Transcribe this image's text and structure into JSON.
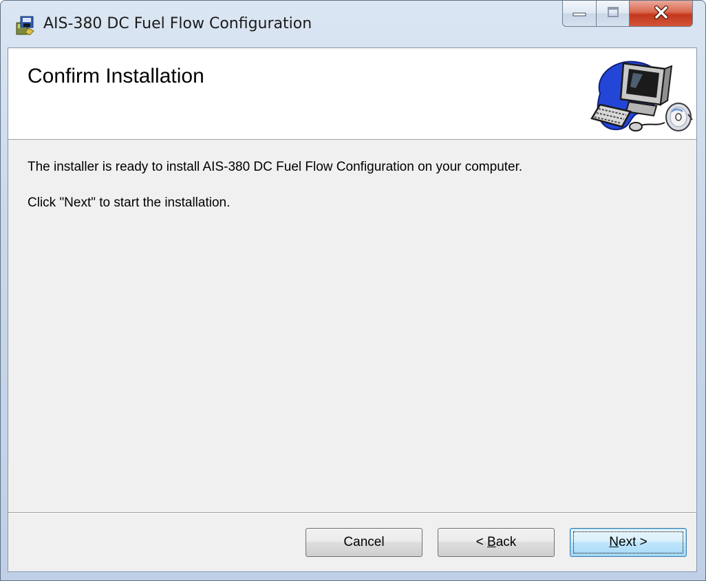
{
  "window": {
    "title": "AIS-380 DC Fuel Flow Configuration",
    "app_icon": "installer-package-icon",
    "caption_buttons": {
      "minimize_icon": "minimize-icon",
      "maximize_icon": "maximize-icon",
      "close_icon": "close-icon"
    }
  },
  "banner": {
    "title": "Confirm Installation",
    "graphic": "computer-with-disc-icon"
  },
  "body": {
    "line1": "The installer is ready to install AIS-380 DC Fuel Flow Configuration on your computer.",
    "line2": "Click \"Next\" to start the installation."
  },
  "buttons": {
    "cancel": "Cancel",
    "back_prefix": "< ",
    "back_mnemonic": "B",
    "back_rest": "ack",
    "next_mnemonic": "N",
    "next_rest": "ext >",
    "default": "next"
  },
  "colors": {
    "dialog_background": "#f0f0f0",
    "banner_background": "#ffffff",
    "close_button": "#c3371c",
    "default_button_border": "#3c7fb1"
  }
}
